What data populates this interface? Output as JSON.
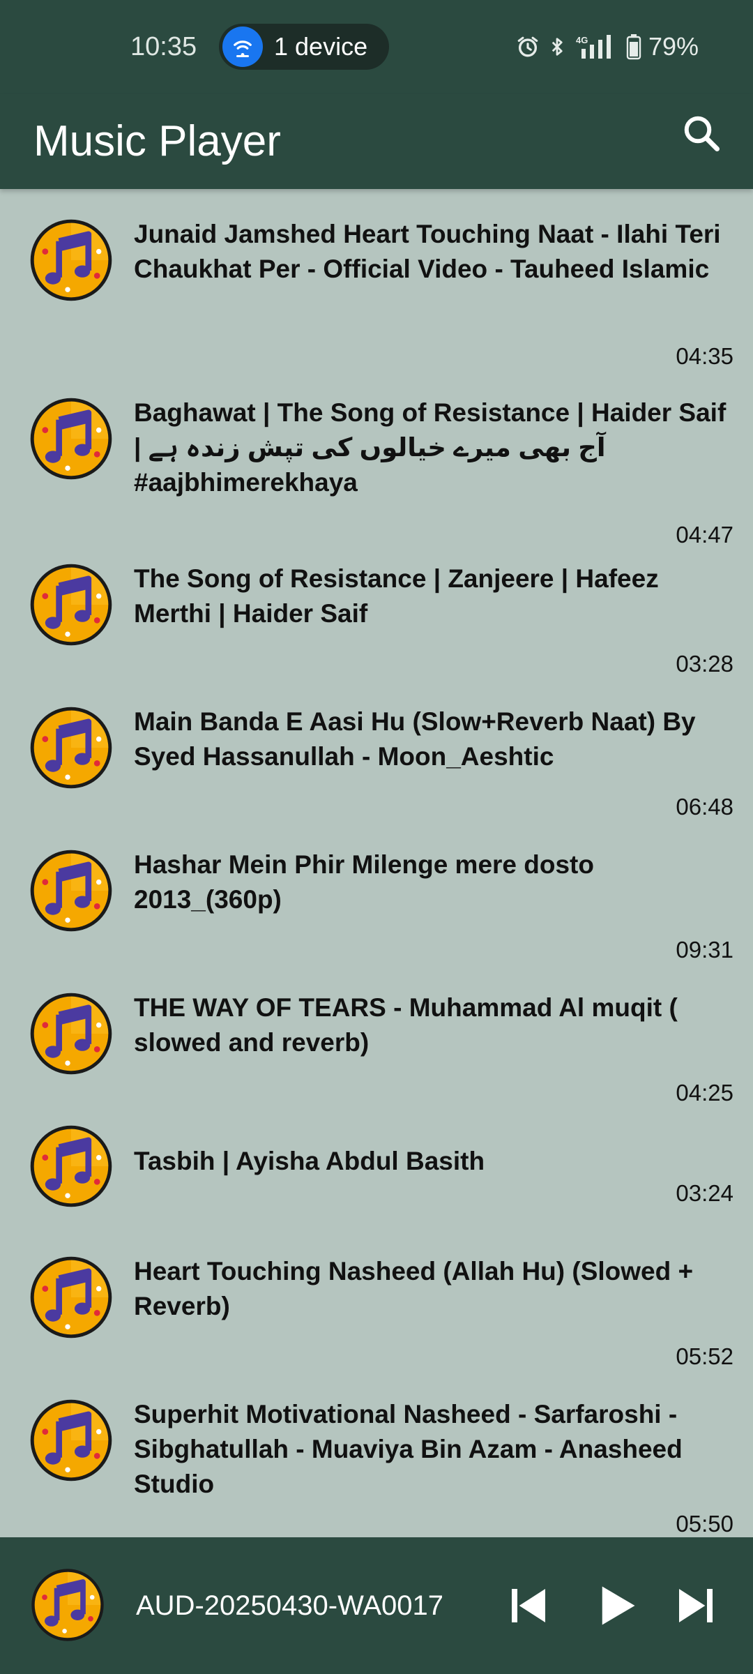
{
  "status": {
    "time": "10:35",
    "device_chip": "1 device",
    "battery": "79%",
    "icons": [
      "alarm-icon",
      "bluetooth-icon",
      "signal-4g-icon",
      "battery-icon"
    ]
  },
  "app_bar": {
    "title": "Music Player",
    "search_icon": "search-icon"
  },
  "colors": {
    "primary": "#2b4a40",
    "background": "#b5c5bf",
    "art_orange": "#f5a800",
    "art_note": "#4b3aa0"
  },
  "songs": [
    {
      "title": "Junaid Jamshed Heart Touching Naat - Ilahi Teri Chaukhat Per - Official Video - Tauheed Islamic",
      "duration": "04:35"
    },
    {
      "title": "Baghawat | The Song of Resistance | Haider Saif | آج بھی میرے خیالوں کی تپش زندہ ہے #aajbhimerekhaya",
      "duration": "04:47"
    },
    {
      "title": "The Song of Resistance | Zanjeere | Hafeez Merthi | Haider Saif",
      "duration": "03:28"
    },
    {
      "title": "Main Banda E Aasi Hu (Slow+Reverb Naat) By Syed Hassanullah - Moon_Aeshtic",
      "duration": "06:48"
    },
    {
      "title": "Hashar Mein Phir Milenge mere dosto 2013_(360p)",
      "duration": "09:31"
    },
    {
      "title": "THE WAY OF TEARS - Muhammad Al muqit ( slowed and reverb)",
      "duration": "04:25"
    },
    {
      "title": "Tasbih | Ayisha Abdul Basith",
      "duration": "03:24"
    },
    {
      "title": "Heart Touching Nasheed (Allah Hu) (Slowed + Reverb)",
      "duration": "05:52"
    },
    {
      "title": "Superhit Motivational Nasheed - Sarfaroshi - Sibghatullah - Muaviya Bin Azam - Anasheed Studio",
      "duration": "05:50"
    }
  ],
  "player": {
    "now_playing": "AUD-20250430-WA0017",
    "controls": [
      "previous-icon",
      "play-icon",
      "next-icon"
    ]
  }
}
